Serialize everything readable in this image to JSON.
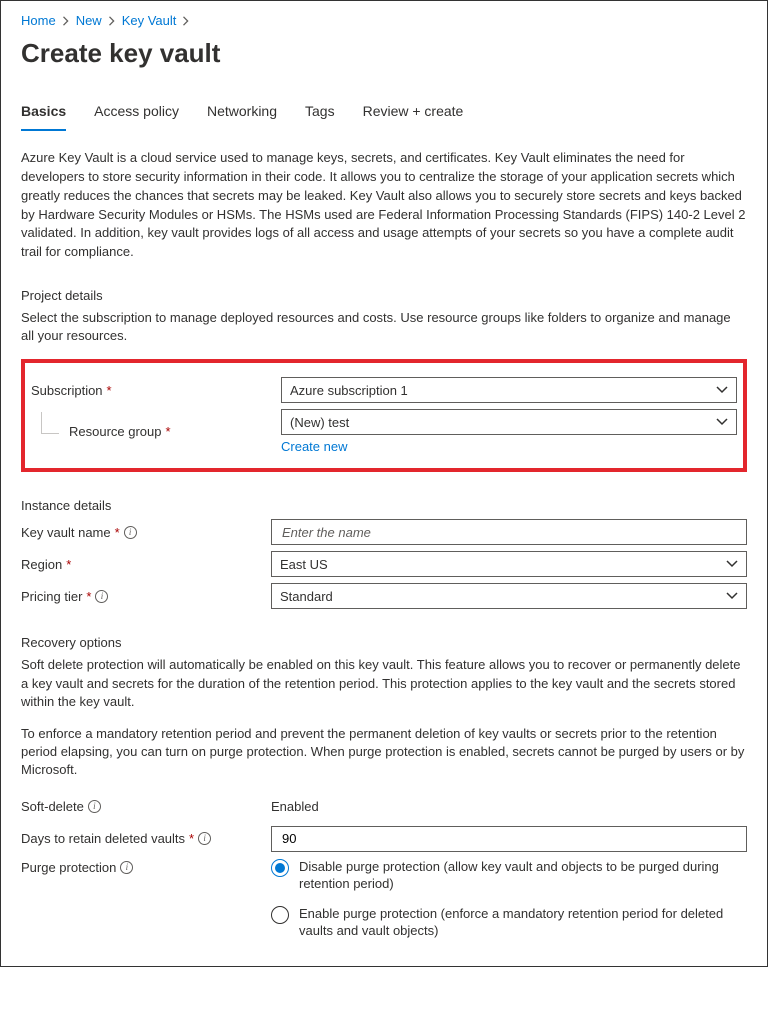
{
  "breadcrumb": {
    "items": [
      {
        "label": "Home"
      },
      {
        "label": "New"
      },
      {
        "label": "Key Vault"
      }
    ]
  },
  "page_title": "Create key vault",
  "tabs": [
    {
      "label": "Basics",
      "active": true
    },
    {
      "label": "Access policy"
    },
    {
      "label": "Networking"
    },
    {
      "label": "Tags"
    },
    {
      "label": "Review + create"
    }
  ],
  "intro_text": "Azure Key Vault is a cloud service used to manage keys, secrets, and certificates. Key Vault eliminates the need for developers to store security information in their code. It allows you to centralize the storage of your application secrets which greatly reduces the chances that secrets may be leaked. Key Vault also allows you to securely store secrets and keys backed by Hardware Security Modules or HSMs. The HSMs used are Federal Information Processing Standards (FIPS) 140-2 Level 2 validated. In addition, key vault provides logs of all access and usage attempts of your secrets so you have a complete audit trail for compliance.",
  "project_details": {
    "heading": "Project details",
    "desc": "Select the subscription to manage deployed resources and costs. Use resource groups like folders to organize and manage all your resources.",
    "subscription": {
      "label": "Subscription",
      "value": "Azure subscription 1"
    },
    "resource_group": {
      "label": "Resource group",
      "value": "(New) test",
      "create_new": "Create new"
    }
  },
  "instance_details": {
    "heading": "Instance details",
    "key_vault_name": {
      "label": "Key vault name",
      "placeholder": "Enter the name",
      "value": ""
    },
    "region": {
      "label": "Region",
      "value": "East US"
    },
    "pricing_tier": {
      "label": "Pricing tier",
      "value": "Standard"
    }
  },
  "recovery": {
    "heading": "Recovery options",
    "desc1": "Soft delete protection will automatically be enabled on this key vault. This feature allows you to recover or permanently delete a key vault and secrets for the duration of the retention period. This protection applies to the key vault and the secrets stored within the key vault.",
    "desc2": "To enforce a mandatory retention period and prevent the permanent deletion of key vaults or secrets prior to the retention period elapsing, you can turn on purge protection. When purge protection is enabled, secrets cannot be purged by users or by Microsoft.",
    "soft_delete": {
      "label": "Soft-delete",
      "value": "Enabled"
    },
    "retention_days": {
      "label": "Days to retain deleted vaults",
      "value": "90"
    },
    "purge_protection": {
      "label": "Purge protection",
      "options": [
        {
          "label": "Disable purge protection (allow key vault and objects to be purged during retention period)",
          "selected": true
        },
        {
          "label": "Enable purge protection (enforce a mandatory retention period for deleted vaults and vault objects)",
          "selected": false
        }
      ]
    }
  }
}
